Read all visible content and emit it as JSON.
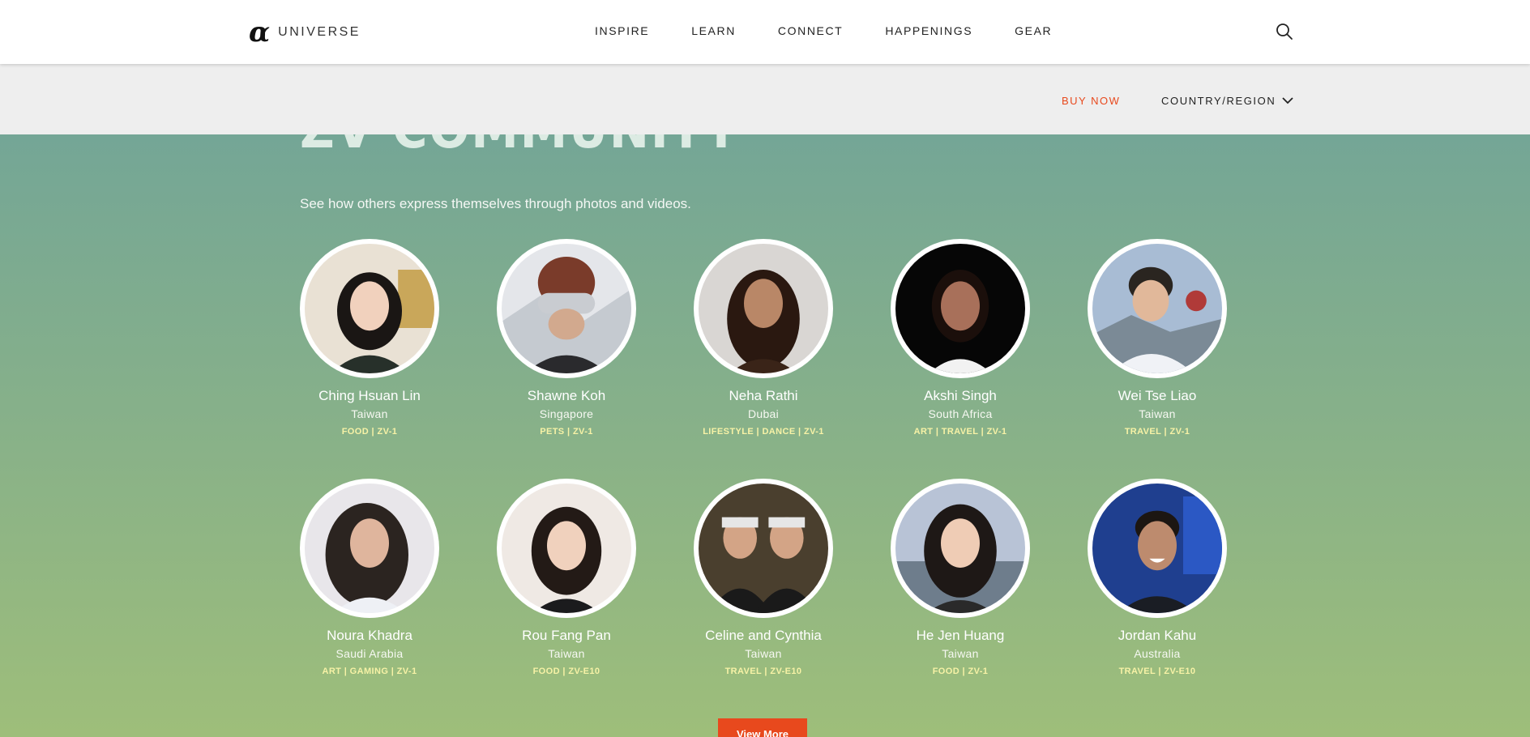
{
  "header": {
    "logo_mark": "α",
    "logo_text": "UNIVERSE",
    "nav": [
      "INSPIRE",
      "LEARN",
      "CONNECT",
      "HAPPENINGS",
      "GEAR"
    ],
    "search_icon": "search-icon"
  },
  "subnav": {
    "buy_now": "BUY NOW",
    "country_region": "COUNTRY/REGION",
    "accent_color": "#e8491d"
  },
  "main": {
    "heading": "ZV COMMUNITY",
    "subtitle": "See how others express themselves through photos and videos.",
    "creators": [
      {
        "name": "Ching Hsuan Lin",
        "country": "Taiwan",
        "tags": "FOOD   |  ZV-1"
      },
      {
        "name": "Shawne Koh",
        "country": "Singapore",
        "tags": "PETS   |  ZV-1"
      },
      {
        "name": "Neha Rathi",
        "country": "Dubai",
        "tags": "LIFESTYLE | DANCE   |  ZV-1"
      },
      {
        "name": "Akshi Singh",
        "country": "South Africa",
        "tags": "ART | TRAVEL   |  ZV-1"
      },
      {
        "name": "Wei Tse Liao",
        "country": "Taiwan",
        "tags": "TRAVEL   |  ZV-1"
      },
      {
        "name": "Noura Khadra",
        "country": "Saudi Arabia",
        "tags": "ART | GAMING   |  ZV-1"
      },
      {
        "name": "Rou Fang Pan",
        "country": "Taiwan",
        "tags": "FOOD   |  ZV-E10"
      },
      {
        "name": "Celine and Cynthia",
        "country": "Taiwan",
        "tags": "TRAVEL   |  ZV-E10"
      },
      {
        "name": "He Jen Huang",
        "country": "Taiwan",
        "tags": "FOOD   |  ZV-1"
      },
      {
        "name": "Jordan Kahu",
        "country": "Australia",
        "tags": "TRAVEL   |  ZV-E10"
      }
    ],
    "view_more": "View More"
  }
}
